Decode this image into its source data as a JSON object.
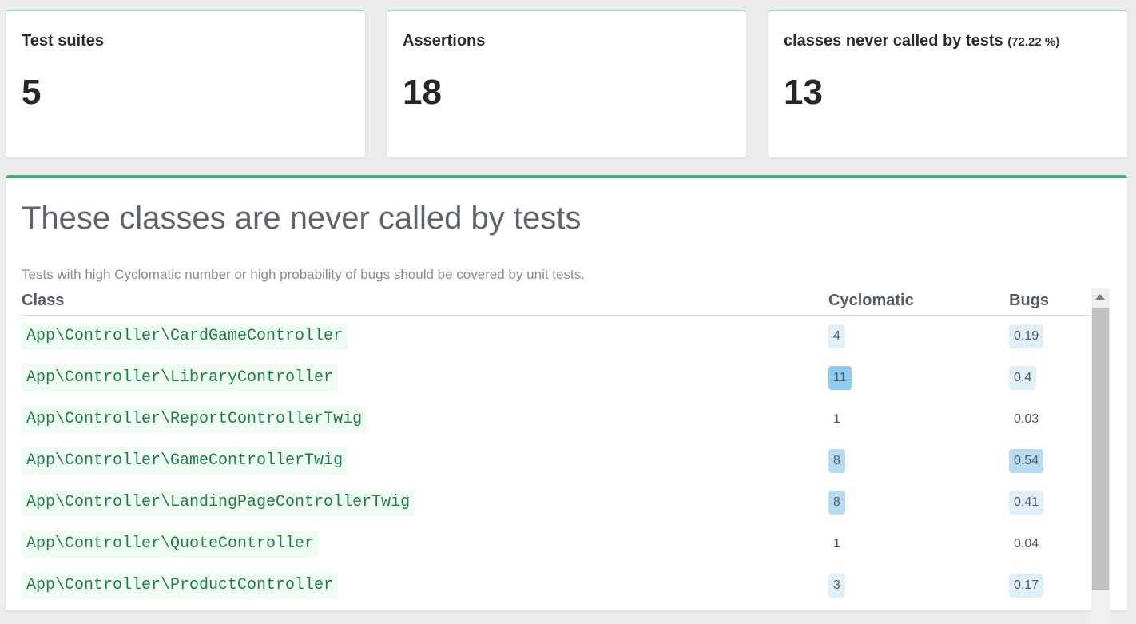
{
  "cards": [
    {
      "title": "Test suites",
      "value": "5"
    },
    {
      "title": "Assertions",
      "value": "18"
    },
    {
      "title": "classes never called by tests",
      "percent": "(72.22 %)",
      "value": "13"
    }
  ],
  "panel": {
    "title": "These classes are never called by tests",
    "description": "Tests with high Cyclomatic number or high probability of bugs should be covered by unit tests.",
    "columns": {
      "class": "Class",
      "cyclomatic": "Cyclomatic",
      "bugs": "Bugs"
    },
    "rows": [
      {
        "class": "App\\Controller\\CardGameController",
        "cyclomatic": "4",
        "bugs": "0.19"
      },
      {
        "class": "App\\Controller\\LibraryController",
        "cyclomatic": "11",
        "bugs": "0.4"
      },
      {
        "class": "App\\Controller\\ReportControllerTwig",
        "cyclomatic": "1",
        "bugs": "0.03"
      },
      {
        "class": "App\\Controller\\GameControllerTwig",
        "cyclomatic": "8",
        "bugs": "0.54"
      },
      {
        "class": "App\\Controller\\LandingPageControllerTwig",
        "cyclomatic": "8",
        "bugs": "0.41"
      },
      {
        "class": "App\\Controller\\QuoteController",
        "cyclomatic": "1",
        "bugs": "0.04"
      },
      {
        "class": "App\\Controller\\ProductController",
        "cyclomatic": "3",
        "bugs": "0.17"
      }
    ]
  },
  "colors": {
    "accent": "#3fb573",
    "class_text": "#1e7d4a",
    "class_bg": "#effcf2",
    "badge_light": "#dff0fb",
    "badge_mid": "#b6dcf4",
    "badge_strong": "#8ecdf0"
  }
}
